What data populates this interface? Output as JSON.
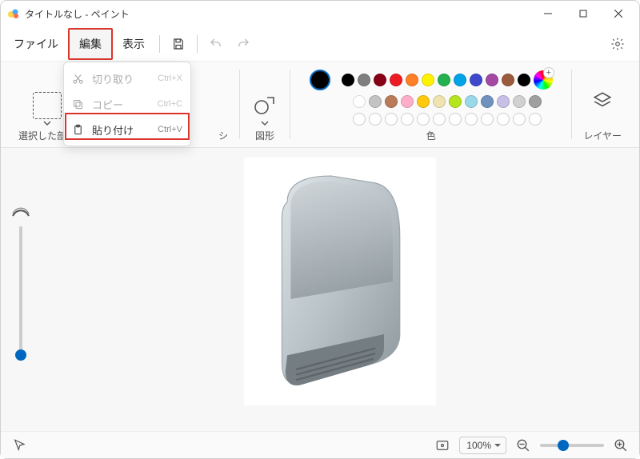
{
  "window": {
    "title": "タイトルなし - ペイント"
  },
  "menu": {
    "file": "ファイル",
    "edit": "編集",
    "view": "表示"
  },
  "edit_menu": {
    "cut": {
      "label": "切り取り",
      "shortcut": "Ctrl+X"
    },
    "copy": {
      "label": "コピー",
      "shortcut": "Ctrl+C"
    },
    "paste": {
      "label": "貼り付け",
      "shortcut": "Ctrl+V"
    }
  },
  "ribbon": {
    "selection_label": "選択した部分",
    "brush_label": "シ",
    "shapes_label": "図形",
    "colors_label": "色",
    "layers_label": "レイヤー"
  },
  "colors": {
    "row1": [
      "#000000",
      "#7f7f7f",
      "#880015",
      "#ed1c24",
      "#ff7f27",
      "#fff200",
      "#22b14c",
      "#00a2e8",
      "#3f48cc",
      "#a349a4",
      "#9c5a3c",
      "#000000"
    ],
    "row2": [
      "#ffffff",
      "#c3c3c3",
      "#b97a57",
      "#ffaec9",
      "#ffc90e",
      "#efe4b0",
      "#b5e61d",
      "#99d9ea",
      "#7092be",
      "#c8bfe7",
      "#d1d1d1",
      "#a0a0a0"
    ],
    "row3_empty_count": 12,
    "current": "#000000"
  },
  "status": {
    "zoom": "100%"
  }
}
